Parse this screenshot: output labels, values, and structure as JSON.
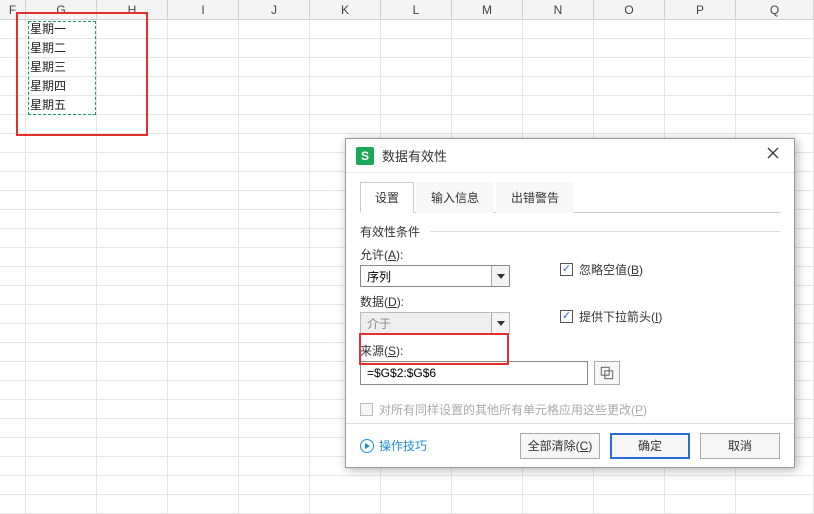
{
  "columns": [
    "F",
    "G",
    "H",
    "I",
    "J",
    "K",
    "L",
    "M",
    "N",
    "O",
    "P",
    "Q"
  ],
  "cells_G": [
    "星期一",
    "星期二",
    "星期三",
    "星期四",
    "星期五"
  ],
  "dialog": {
    "logo": "S",
    "title": "数据有效性",
    "tabs": {
      "settings": "设置",
      "input_msg": "输入信息",
      "error_alert": "出错警告"
    },
    "section": "有效性条件",
    "allow_label": "允许",
    "allow_key": "A",
    "allow_value": "序列",
    "data_label": "数据",
    "data_key": "D",
    "data_value": "介于",
    "source_label": "来源",
    "source_key": "S",
    "source_value": "=$G$2:$G$6",
    "ignore_blank": "忽略空值",
    "ignore_blank_key": "B",
    "dropdown": "提供下拉箭头",
    "dropdown_key": "I",
    "apply_all": "对所有同样设置的其他所有单元格应用这些更改",
    "apply_all_key": "P",
    "tips": "操作技巧",
    "btn_clear": "全部清除",
    "btn_clear_key": "C",
    "btn_ok": "确定",
    "btn_cancel": "取消"
  }
}
